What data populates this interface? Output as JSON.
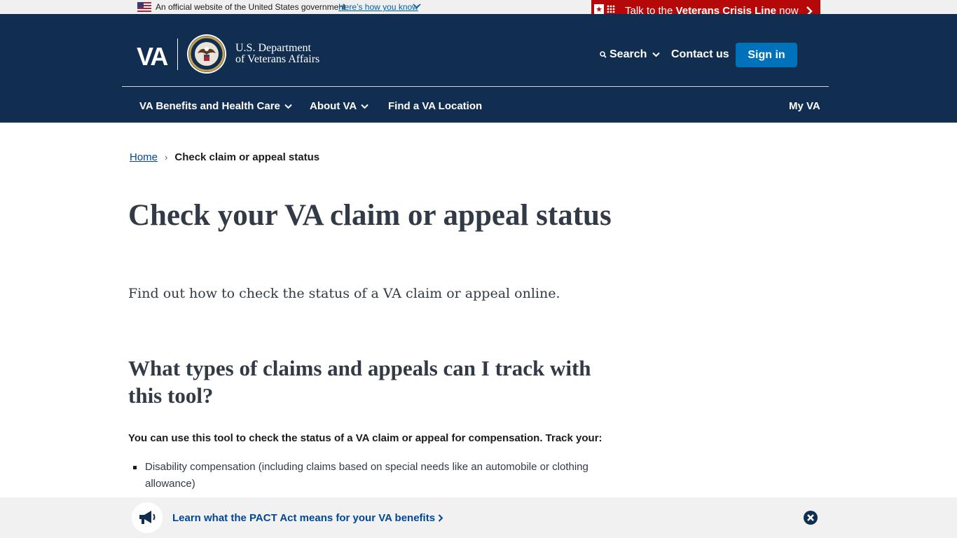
{
  "gov_banner": {
    "text": "An official website of the United States government",
    "link": "Here’s how you know"
  },
  "crisis_line": {
    "prefix": "Talk to the ",
    "bold": "Veterans Crisis Line",
    "suffix": " now"
  },
  "header": {
    "logo": "VA",
    "dept_line1": "U.S. Department",
    "dept_line2": "of Veterans Affairs",
    "search_label": "Search",
    "contact_label": "Contact us",
    "signin_label": "Sign in"
  },
  "nav": {
    "items": [
      {
        "label": "VA Benefits and Health Care"
      },
      {
        "label": "About VA"
      },
      {
        "label": "Find a VA Location"
      }
    ],
    "my_va": "My VA"
  },
  "breadcrumb": {
    "home": "Home",
    "separator": "›",
    "current": "Check claim or appeal status"
  },
  "main": {
    "title": "Check your VA claim or appeal status",
    "intro": "Find out how to check the status of a VA claim or appeal online.",
    "h2": "What types of claims and appeals can I track with this tool?",
    "lead": "You can use this tool to check the status of a VA claim or appeal for compensation. Track your:",
    "bullets": [
      "Disability compensation (including claims based on special needs like an automobile or clothing allowance)"
    ]
  },
  "promo": {
    "link": "Learn what the PACT Act means for your VA benefits"
  },
  "colors": {
    "header_bg": "#112e51",
    "crisis_red": "#b50909",
    "signin_blue": "#0071bb",
    "link_blue": "#004795"
  }
}
